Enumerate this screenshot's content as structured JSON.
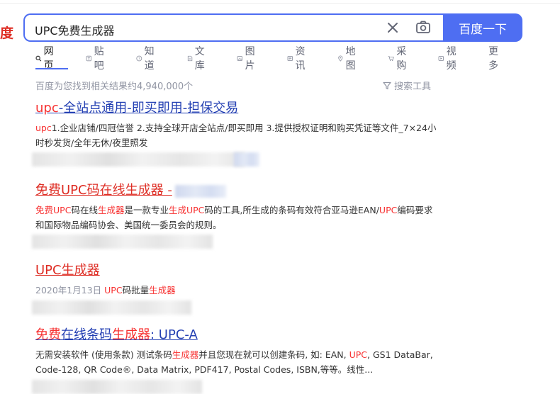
{
  "logo_fragment": "度",
  "search": {
    "query": "UPC免费生成器",
    "button_label": "百度一下"
  },
  "tabs": [
    {
      "label": "网页",
      "icon": "search-icon",
      "active": true
    },
    {
      "label": "贴吧",
      "icon": "tieba-icon"
    },
    {
      "label": "知道",
      "icon": "question-icon"
    },
    {
      "label": "文库",
      "icon": "document-icon"
    },
    {
      "label": "图片",
      "icon": "image-icon"
    },
    {
      "label": "资讯",
      "icon": "news-icon"
    },
    {
      "label": "地图",
      "icon": "map-icon"
    },
    {
      "label": "采购",
      "icon": "cart-icon"
    },
    {
      "label": "视频",
      "icon": "video-icon"
    },
    {
      "label": "更多"
    }
  ],
  "result_count": "百度为您找到相关结果约4,940,000个",
  "tools_label": "搜索工具",
  "results": [
    {
      "title_em": "upc",
      "title_rest": "-全站点通用-即买即用-担保交易",
      "desc_em": "upc",
      "desc_rest": "1.企业店铺/四冠信誉 2.支持全球开店全站点/即买即用 3.提供授权证明和购买凭证等文件_7×24小时秒发货/全年无休/夜里照发"
    },
    {
      "title": "免费UPC码在线生成器 - ",
      "desc_parts": [
        {
          "t": "免费"
        },
        {
          "t": "UPC"
        },
        {
          "t": "码在线"
        },
        {
          "t": "生成器"
        },
        {
          "t": "是一款专业"
        },
        {
          "t": "生成"
        },
        {
          "t": "UPC"
        },
        {
          "t": "码的工具,所生成的条码有效符合亚马逊EAN/"
        },
        {
          "t": "UPC"
        },
        {
          "t": "编码要求和国际物品编码协会、美国统一委员会的规则。"
        }
      ]
    },
    {
      "title": "UPC生成器",
      "date": "2020年1月13日",
      "desc_em1": "UPC",
      "desc_mid": "码批量",
      "desc_em2": "生成器"
    },
    {
      "title_a": "免费",
      "title_b": "在线条码",
      "title_c": "生成器",
      "title_d": ": UPC-A",
      "desc_parts": [
        {
          "t": "无需安装软件 (使用条款) 测试条码"
        },
        {
          "t": "生成器"
        },
        {
          "t": "并且您现在就可以创建条码, 如: EAN, "
        },
        {
          "t": "UPC"
        },
        {
          "t": ", GS1 DataBar, Code-128, QR Code®, Data Matrix, PDF417, Postal Codes, ISBN,等等。线性..."
        }
      ]
    }
  ]
}
